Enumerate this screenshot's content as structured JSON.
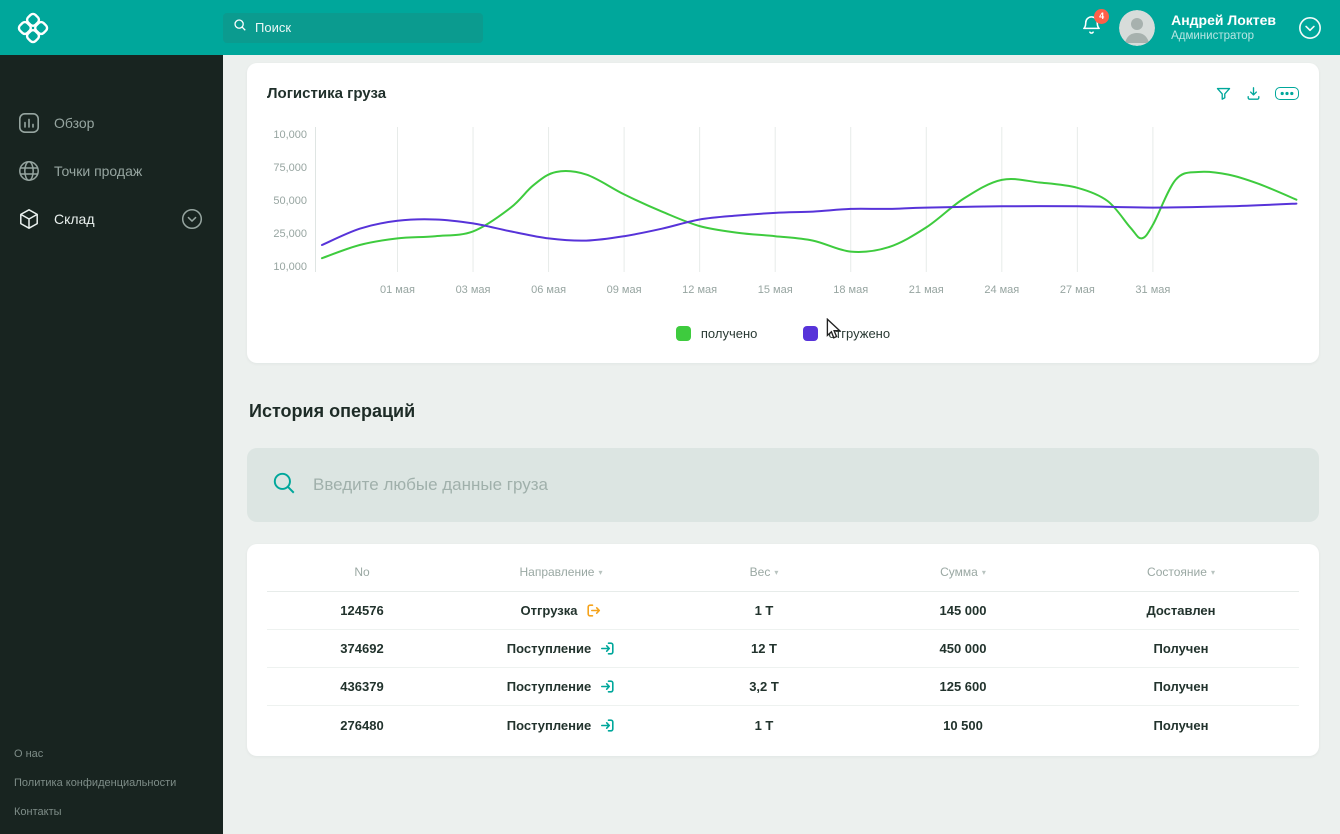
{
  "colors": {
    "teal": "#00a79b",
    "green_series": "#3ecb3e",
    "purple_series": "#5733d9",
    "orange_out": "#f5a31c"
  },
  "header": {
    "search_placeholder": "Поиск",
    "notification_count": "4",
    "user_name": "Андрей Локтев",
    "user_role": "Администратор"
  },
  "sidebar": {
    "items": [
      {
        "id": "overview",
        "label": "Обзор",
        "icon": "bar-chart-icon",
        "active": false,
        "expandable": false
      },
      {
        "id": "sales-points",
        "label": "Точки продаж",
        "icon": "globe-icon",
        "active": false,
        "expandable": false
      },
      {
        "id": "warehouse",
        "label": "Склад",
        "icon": "box-icon",
        "active": true,
        "expandable": true
      }
    ],
    "footer_links": [
      "О нас",
      "Политика конфиденциальности",
      "Контакты"
    ]
  },
  "logistics": {
    "title": "Логистика груза",
    "legend": [
      {
        "label": "получено",
        "color": "#3ecb3e"
      },
      {
        "label": "отгружено",
        "color": "#5733d9"
      }
    ]
  },
  "chart_data": {
    "type": "line",
    "title": "Логистика груза",
    "legend_position": "bottom",
    "grid": "vertical",
    "y_tick_labels": [
      "10,000",
      "75,000",
      "50,000",
      "25,000",
      "10,000"
    ],
    "x_tick_labels": [
      "01 мая",
      "03 мая",
      "06 мая",
      "09 мая",
      "12 мая",
      "15 мая",
      "18 мая",
      "21 мая",
      "24 мая",
      "27 мая",
      "31 мая"
    ],
    "y_unit": "thousands",
    "series": [
      {
        "name": "получено",
        "color": "#3ecb3e",
        "points": [
          [
            0,
            14
          ],
          [
            0.5,
            20
          ],
          [
            1,
            23
          ],
          [
            1.5,
            24
          ],
          [
            2,
            27
          ],
          [
            2.5,
            45
          ],
          [
            2.8,
            62
          ],
          [
            3.1,
            72
          ],
          [
            3.5,
            70
          ],
          [
            4,
            55
          ],
          [
            4.5,
            42
          ],
          [
            5,
            31
          ],
          [
            5.5,
            26
          ],
          [
            6,
            24
          ],
          [
            6.5,
            22
          ],
          [
            7,
            17
          ],
          [
            7.5,
            19
          ],
          [
            8,
            30
          ],
          [
            8.5,
            52
          ],
          [
            9,
            66
          ],
          [
            9.5,
            64
          ],
          [
            10,
            60
          ],
          [
            10.4,
            50
          ],
          [
            10.7,
            30
          ],
          [
            10.85,
            23
          ],
          [
            11,
            32
          ],
          [
            11.3,
            66
          ],
          [
            11.6,
            72
          ],
          [
            12,
            70
          ],
          [
            12.4,
            63
          ],
          [
            12.9,
            51
          ]
        ]
      },
      {
        "name": "отгружено",
        "color": "#5733d9",
        "points": [
          [
            0,
            20
          ],
          [
            0.5,
            29
          ],
          [
            1,
            35
          ],
          [
            1.5,
            36
          ],
          [
            2,
            33
          ],
          [
            2.5,
            27
          ],
          [
            3,
            23
          ],
          [
            3.5,
            22
          ],
          [
            4,
            24
          ],
          [
            4.5,
            29
          ],
          [
            5,
            36
          ],
          [
            5.5,
            39
          ],
          [
            6,
            41
          ],
          [
            6.5,
            42
          ],
          [
            7,
            44
          ],
          [
            7.5,
            44
          ],
          [
            8,
            45
          ],
          [
            9,
            46
          ],
          [
            10,
            46
          ],
          [
            11,
            45
          ],
          [
            12,
            46
          ],
          [
            12.9,
            48
          ]
        ]
      }
    ]
  },
  "history": {
    "title": "История операций",
    "search_placeholder": "Введите любые данные груза",
    "table": {
      "columns": [
        {
          "label": "No",
          "sortable": false
        },
        {
          "label": "Направление",
          "sortable": true
        },
        {
          "label": "Вес",
          "sortable": true
        },
        {
          "label": "Сумма",
          "sortable": true
        },
        {
          "label": "Состояние",
          "sortable": true
        }
      ],
      "rows": [
        {
          "no": "124576",
          "direction": "Отгрузка",
          "direction_type": "out",
          "direction_icon": "logout-arrow-icon",
          "weight": "1 Т",
          "amount": "145 000",
          "status": "Доставлен"
        },
        {
          "no": "374692",
          "direction": "Поступление",
          "direction_type": "in",
          "direction_icon": "login-arrow-icon",
          "weight": "12 Т",
          "amount": "450 000",
          "status": "Получен"
        },
        {
          "no": "436379",
          "direction": "Поступление",
          "direction_type": "in",
          "direction_icon": "login-arrow-icon",
          "weight": "3,2 Т",
          "amount": "125 600",
          "status": "Получен"
        },
        {
          "no": "276480",
          "direction": "Поступление",
          "direction_type": "in",
          "direction_icon": "login-arrow-icon",
          "weight": "1 Т",
          "amount": "10 500",
          "status": "Получен"
        }
      ]
    }
  }
}
